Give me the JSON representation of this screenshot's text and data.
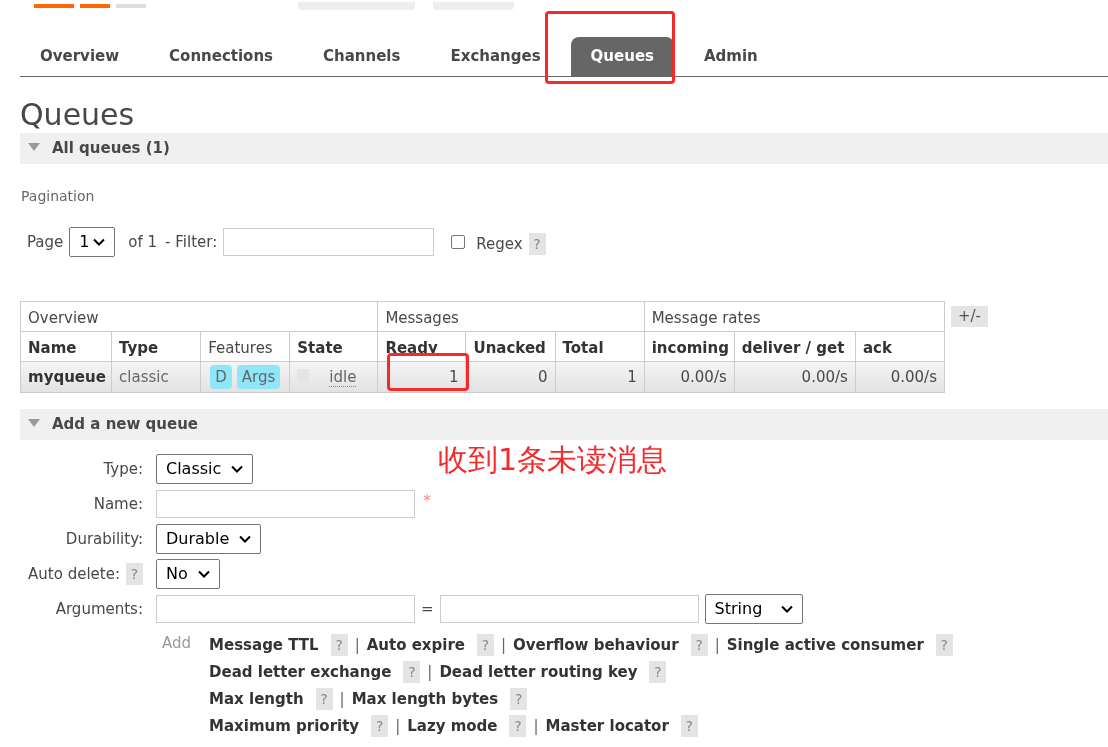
{
  "tabs": [
    {
      "label": "Overview",
      "selected": false,
      "highlighted": false
    },
    {
      "label": "Connections",
      "selected": false,
      "highlighted": false
    },
    {
      "label": "Channels",
      "selected": false,
      "highlighted": false
    },
    {
      "label": "Exchanges",
      "selected": false,
      "highlighted": false
    },
    {
      "label": "Queues",
      "selected": true,
      "highlighted": true
    },
    {
      "label": "Admin",
      "selected": false,
      "highlighted": false
    }
  ],
  "page_title": "Queues",
  "all_queues": {
    "title": "All queues (1)",
    "expanded": true
  },
  "pagination": {
    "heading": "Pagination",
    "page_label": "Page",
    "page_value": "1",
    "of_label": "of 1",
    "filter_label": "- Filter:",
    "regex_checked": false,
    "regex_label": "Regex",
    "help": "?"
  },
  "table": {
    "groups": [
      {
        "label": "Overview",
        "columns": [
          {
            "label": "Name",
            "bold": true
          },
          {
            "label": "Type",
            "bold": true
          },
          {
            "label": "Features",
            "bold": false
          },
          {
            "label": "State",
            "bold": true
          }
        ]
      },
      {
        "label": "Messages",
        "columns": [
          {
            "label": "Ready",
            "bold": true
          },
          {
            "label": "Unacked",
            "bold": true
          },
          {
            "label": "Total",
            "bold": true
          }
        ]
      },
      {
        "label": "Message rates",
        "columns": [
          {
            "label": "incoming",
            "bold": true
          },
          {
            "label": "deliver / get",
            "bold": true
          },
          {
            "label": "ack",
            "bold": true
          }
        ]
      }
    ],
    "rows": [
      {
        "name": "myqueue",
        "type": "classic",
        "features": [
          "D",
          "Args"
        ],
        "state": "idle",
        "values": [
          {
            "text": "1",
            "highlighted": true
          },
          {
            "text": "0",
            "highlighted": false
          },
          {
            "text": "1",
            "highlighted": false
          },
          {
            "text": "0.00/s",
            "highlighted": false
          },
          {
            "text": "0.00/s",
            "highlighted": false
          },
          {
            "text": "0.00/s",
            "highlighted": false
          }
        ]
      }
    ],
    "toggle": "+/-"
  },
  "annotation": {
    "text": "收到1条未读消息"
  },
  "add_queue": {
    "title": "Add a new queue",
    "expanded": true,
    "fields": [
      {
        "kind": "select",
        "label": "Type:",
        "value": "Classic"
      },
      {
        "kind": "text",
        "label": "Name:",
        "required_mark": "*"
      },
      {
        "kind": "select",
        "label": "Durability:",
        "value": "Durable"
      },
      {
        "kind": "select",
        "label": "Auto delete:",
        "help": "?",
        "value": "No"
      },
      {
        "kind": "arguments",
        "label": "Arguments:",
        "equals": "=",
        "value": "String"
      }
    ],
    "add_label": "Add",
    "argument_lines": [
      [
        {
          "kind": "link",
          "label": "Message TTL",
          "help": "?"
        },
        {
          "kind": "sep",
          "label": "|"
        },
        {
          "kind": "link",
          "label": "Auto expire",
          "help": "?"
        },
        {
          "kind": "sep",
          "label": "|"
        },
        {
          "kind": "link",
          "label": "Overflow behaviour",
          "help": "?"
        },
        {
          "kind": "sep",
          "label": "|"
        },
        {
          "kind": "link",
          "label": "Single active consumer",
          "help": "?"
        }
      ],
      [
        {
          "kind": "link",
          "label": "Dead letter exchange",
          "help": "?"
        },
        {
          "kind": "sep",
          "label": "|"
        },
        {
          "kind": "link",
          "label": "Dead letter routing key",
          "help": "?"
        }
      ],
      [
        {
          "kind": "link",
          "label": "Max length",
          "help": "?"
        },
        {
          "kind": "sep",
          "label": "|"
        },
        {
          "kind": "link",
          "label": "Max length bytes",
          "help": "?"
        }
      ],
      [
        {
          "kind": "link",
          "label": "Maximum priority",
          "help": "?"
        },
        {
          "kind": "sep",
          "label": "|"
        },
        {
          "kind": "link",
          "label": "Lazy mode",
          "help": "?"
        },
        {
          "kind": "sep",
          "label": "|"
        },
        {
          "kind": "link",
          "label": "Master locator",
          "help": "?"
        }
      ]
    ]
  }
}
